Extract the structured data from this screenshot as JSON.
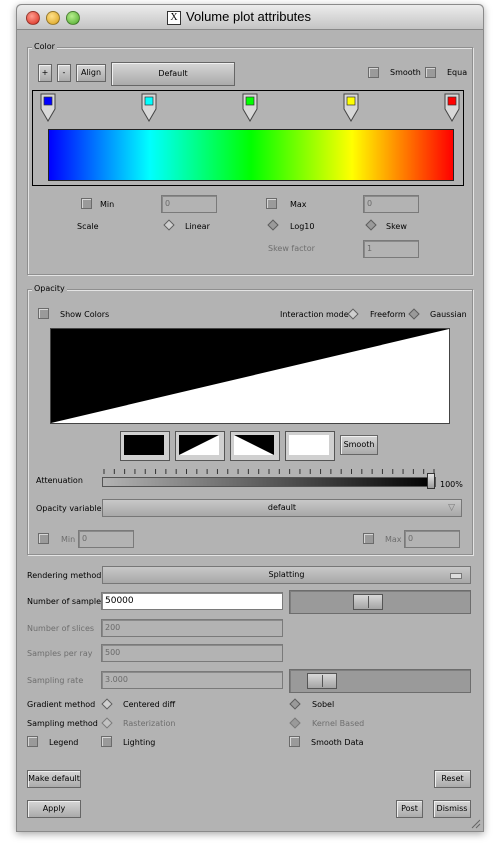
{
  "window": {
    "title": "Volume plot attributes",
    "title_icon": "X"
  },
  "color": {
    "group_title": "Color",
    "add_label": "+",
    "remove_label": "-",
    "align_label": "Align",
    "preset_label": "Default",
    "smooth_label": "Smooth",
    "equal_label": "Equa",
    "point_colors": [
      "#0000ff",
      "#00ffff",
      "#00ff00",
      "#ffff00",
      "#ff0000"
    ],
    "min_label": "Min",
    "min_value": "0",
    "max_label": "Max",
    "max_value": "0",
    "scale_label": "Scale",
    "linear_label": "Linear",
    "log_label": "Log10",
    "skew_label": "Skew",
    "skew_factor_label": "Skew factor",
    "skew_factor_value": "1"
  },
  "opacity": {
    "group_title": "Opacity",
    "show_colors_label": "Show Colors",
    "interaction_mode_label": "Interaction mode",
    "freeform_label": "Freeform",
    "gaussian_label": "Gaussian",
    "smooth_label": "Smooth",
    "attenuation_label": "Attenuation",
    "attenuation_value": "100%",
    "variable_label": "Opacity variable",
    "variable_value": "default",
    "min_label": "Min",
    "min_value": "0",
    "max_label": "Max",
    "max_value": "0"
  },
  "render": {
    "method_label": "Rendering method",
    "method_value": "Splatting",
    "num_samples_label": "Number of samples",
    "num_samples_value": "50000",
    "num_slices_label": "Number of slices",
    "num_slices_value": "200",
    "samples_per_ray_label": "Samples per ray",
    "samples_per_ray_value": "500",
    "sampling_rate_label": "Sampling rate",
    "sampling_rate_value": "3.000",
    "gradient_label": "Gradient method",
    "centered_diff_label": "Centered diff",
    "sobel_label": "Sobel",
    "sampling_method_label": "Sampling method",
    "rasterization_label": "Rasterization",
    "kernel_label": "Kernel Based",
    "legend_label": "Legend",
    "lighting_label": "Lighting",
    "smooth_data_label": "Smooth Data"
  },
  "buttons": {
    "make_default": "Make default",
    "reset": "Reset",
    "apply": "Apply",
    "post": "Post",
    "dismiss": "Dismiss"
  }
}
